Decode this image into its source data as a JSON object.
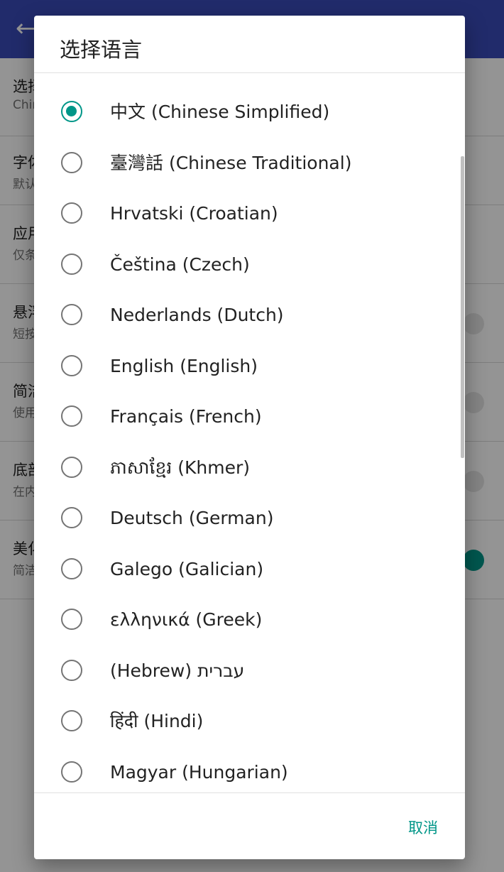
{
  "background": {
    "settings": [
      {
        "title": "选择语言",
        "subtitle": "Chinese Simplified",
        "toggle": null
      },
      {
        "title": "字体",
        "subtitle": "默认",
        "toggle": null
      },
      {
        "title": "应用",
        "subtitle": "仅条",
        "toggle": null
      },
      {
        "title": "悬浮",
        "subtitle": "短按",
        "toggle": "off"
      },
      {
        "title": "简洁",
        "subtitle": "使用",
        "toggle": "off"
      },
      {
        "title": "底部",
        "subtitle": "在内",
        "toggle": "off"
      },
      {
        "title": "美化",
        "subtitle": "简洁",
        "toggle": "on"
      }
    ]
  },
  "dialog": {
    "title": "选择语言",
    "languages": [
      {
        "label": "中文 (Chinese Simplified)",
        "selected": true
      },
      {
        "label": "臺灣話 (Chinese Traditional)",
        "selected": false
      },
      {
        "label": "Hrvatski (Croatian)",
        "selected": false
      },
      {
        "label": "Čeština (Czech)",
        "selected": false
      },
      {
        "label": "Nederlands (Dutch)",
        "selected": false
      },
      {
        "label": "English (English)",
        "selected": false
      },
      {
        "label": "Français (French)",
        "selected": false
      },
      {
        "label": "ភាសាខ្មែរ (Khmer)",
        "selected": false
      },
      {
        "label": "Deutsch (German)",
        "selected": false
      },
      {
        "label": "Galego (Galician)",
        "selected": false
      },
      {
        "label": "ελληνικά (Greek)",
        "selected": false
      },
      {
        "label": "(Hebrew) עברית",
        "selected": false
      },
      {
        "label": "हिंदी (Hindi)",
        "selected": false
      },
      {
        "label": "Magyar (Hungarian)",
        "selected": false
      }
    ],
    "cancel_label": "取消"
  },
  "colors": {
    "appbar": "#3a4ab8",
    "accent": "#009688",
    "scrim": "rgba(0,0,0,0.42)"
  },
  "icons": {
    "back": "arrow-left-icon"
  }
}
